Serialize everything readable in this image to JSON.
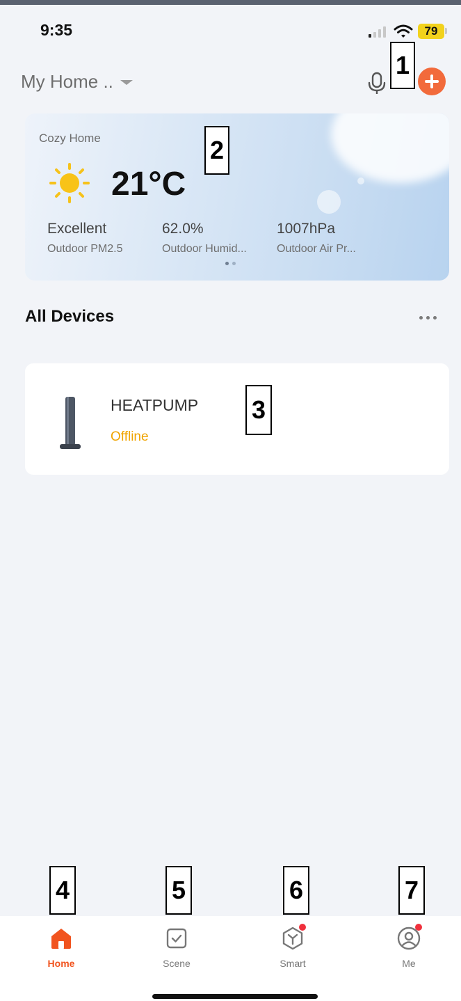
{
  "status_bar": {
    "time": "9:35",
    "battery": "79"
  },
  "header": {
    "home_name": "My Home ..",
    "colors": {
      "accent": "#f26a3b"
    }
  },
  "weather": {
    "title": "Cozy Home",
    "temperature": "21°C",
    "icon": "sun-icon",
    "stats": [
      {
        "value": "Excellent",
        "label": "Outdoor PM2.5"
      },
      {
        "value": "62.0%",
        "label": "Outdoor Humid..."
      },
      {
        "value": "1007hPa",
        "label": "Outdoor Air Pr..."
      }
    ]
  },
  "devices": {
    "title": "All Devices",
    "items": [
      {
        "name": "HEATPUMP",
        "status": "Offline",
        "status_color": "#f0a400"
      }
    ]
  },
  "tabs": [
    {
      "label": "Home",
      "icon": "home-icon",
      "active": true
    },
    {
      "label": "Scene",
      "icon": "scene-icon",
      "active": false
    },
    {
      "label": "Smart",
      "icon": "smart-icon",
      "active": false,
      "badge": true
    },
    {
      "label": "Me",
      "icon": "profile-icon",
      "active": false,
      "badge": true
    }
  ],
  "annotations": [
    "1",
    "2",
    "3",
    "4",
    "5",
    "6",
    "7"
  ]
}
